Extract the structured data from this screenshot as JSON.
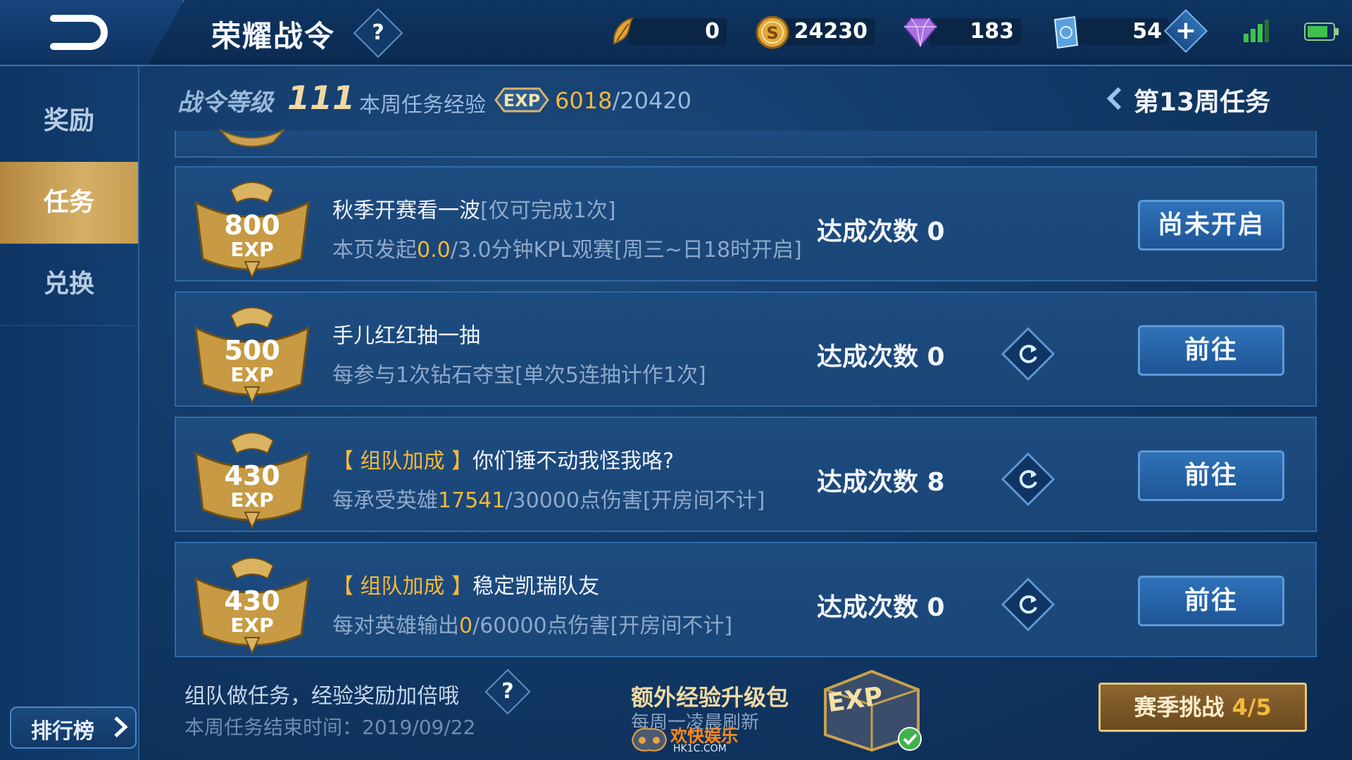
{
  "header": {
    "title": "荣耀战令",
    "resources": [
      {
        "name": "feather-token",
        "value": "0"
      },
      {
        "name": "gold-coin",
        "value": "24230"
      },
      {
        "name": "diamond",
        "value": "183"
      },
      {
        "name": "voucher",
        "value": "54"
      }
    ]
  },
  "sidebar": {
    "items": [
      {
        "label": "奖励"
      },
      {
        "label": "任务"
      },
      {
        "label": "兑换"
      }
    ],
    "rank_label": "排行榜"
  },
  "status": {
    "level_label": "战令等级",
    "level_value": "111",
    "weekly_label": "本周任务经验",
    "exp_current": "6018",
    "exp_total": "/20420",
    "week_nav": "第13周任务"
  },
  "tasks": [
    {
      "exp": "800",
      "exp_unit": "EXP",
      "name": "秋季开赛看一波",
      "limit": "[仅可完成1次]",
      "desc_pre": "本页发起",
      "desc_hl": "0.0",
      "desc_post": "/3.0分钟KPL观赛[周三~日18时开启]",
      "count_label": "达成次数 0",
      "button": "尚未开启"
    },
    {
      "exp": "500",
      "exp_unit": "EXP",
      "name": "手儿红红抽一抽",
      "desc_pre": "每参与1次钻石夺宝[单次5连抽计作1次]",
      "count_label": "达成次数 0",
      "button": "前往"
    },
    {
      "exp": "430",
      "exp_unit": "EXP",
      "tag": "【 组队加成 】",
      "name": "你们锤不动我怪我咯?",
      "desc_pre": "每承受英雄",
      "desc_hl": "17541",
      "desc_post": "/30000点伤害[开房间不计]",
      "count_label": "达成次数 8",
      "button": "前往"
    },
    {
      "exp": "430",
      "exp_unit": "EXP",
      "tag": "【 组队加成 】",
      "name": "稳定凯瑞队友",
      "desc_pre": "每对英雄输出",
      "desc_hl": "0",
      "desc_post": "/60000点伤害[开房间不计]",
      "count_label": "达成次数 0",
      "button": "前往"
    }
  ],
  "footer": {
    "tip": "组队做任务，经验奖励加倍哦",
    "end_time": "本周任务结束时间：2019/09/22",
    "pack_title": "额外经验升级包",
    "pack_sub": "每周一凌晨刷新",
    "season_label": "赛季挑战 ",
    "season_progress": "4/5"
  },
  "watermark": {
    "text": "欢快娱乐",
    "sub": "HK1C.COM"
  },
  "colors": {
    "accent_gold": "#f5b83a",
    "button_blue": "#2f72b8",
    "active_tab": "#c59c52"
  }
}
